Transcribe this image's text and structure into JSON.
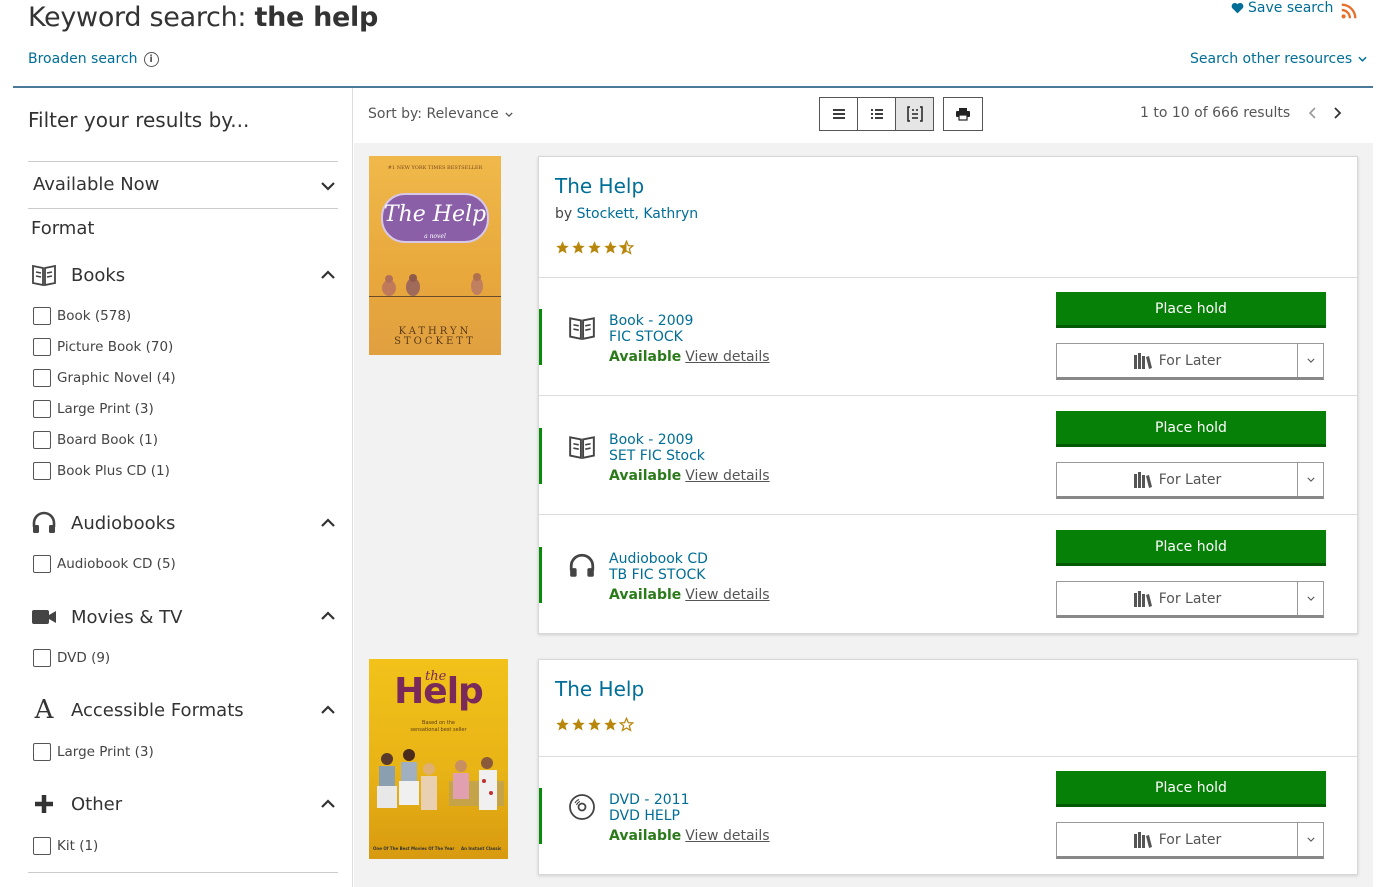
{
  "header": {
    "title_prefix": "Keyword search:",
    "title_query": "the help",
    "broaden_label": "Broaden search",
    "save_search_label": "Save search",
    "other_resources_label": "Search other resources"
  },
  "sidebar": {
    "title": "Filter your results by...",
    "available_now": "Available Now",
    "format_label": "Format",
    "groups": [
      {
        "label": "Books",
        "icon": "book-icon",
        "items": [
          "Book (578)",
          "Picture Book (70)",
          "Graphic Novel (4)",
          "Large Print (3)",
          "Board Book (1)",
          "Book Plus CD (1)"
        ]
      },
      {
        "label": "Audiobooks",
        "icon": "headphones-icon",
        "items": [
          "Audiobook CD (5)"
        ]
      },
      {
        "label": "Movies & TV",
        "icon": "video-camera-icon",
        "items": [
          "DVD (9)"
        ]
      },
      {
        "label": "Accessible Formats",
        "icon": "font-a-icon",
        "items": [
          "Large Print (3)"
        ]
      },
      {
        "label": "Other",
        "icon": "plus-icon",
        "items": [
          "Kit (1)"
        ]
      }
    ]
  },
  "toolbar": {
    "sort_label": "Sort by: Relevance",
    "results_count": "1 to 10 of 666 results"
  },
  "results": [
    {
      "title": "The Help",
      "author_prefix": "by",
      "author": "Stockett, Kathryn",
      "rating": 4.5,
      "cover": {
        "badge": "#1 NEW YORK TIMES BESTSELLER",
        "title": "The Help",
        "subtitle": "a novel",
        "author_line1": "KATHRYN",
        "author_line2": "STOCKETT"
      },
      "items": [
        {
          "format": "Book - 2009",
          "call_number": "FIC STOCK",
          "icon": "book-icon",
          "status": "Available",
          "details": "View details",
          "hold": "Place hold",
          "later": "For Later"
        },
        {
          "format": "Book - 2009",
          "call_number": "SET FIC Stock",
          "icon": "book-icon",
          "status": "Available",
          "details": "View details",
          "hold": "Place hold",
          "later": "For Later"
        },
        {
          "format": "Audiobook CD",
          "call_number": "TB FIC STOCK",
          "icon": "headphones-icon",
          "status": "Available",
          "details": "View details",
          "hold": "Place hold",
          "later": "For Later"
        }
      ]
    },
    {
      "title": "The Help",
      "rating": 4,
      "cover": {
        "title_small": "the",
        "title": "Help",
        "tagline1": "Based on the",
        "tagline2": "sensational best seller",
        "quote": "One Of The Best Movies Of The Year",
        "quote2": "An Instant Classic"
      },
      "items": [
        {
          "format": "DVD - 2011",
          "call_number": "DVD HELP",
          "icon": "disc-icon",
          "status": "Available",
          "details": "View details",
          "hold": "Place hold",
          "later": "For Later"
        }
      ]
    }
  ],
  "colors": {
    "link": "#006e96",
    "hold_green": "#068006",
    "available_green": "#2a7a1a",
    "star": "#b8860b"
  }
}
